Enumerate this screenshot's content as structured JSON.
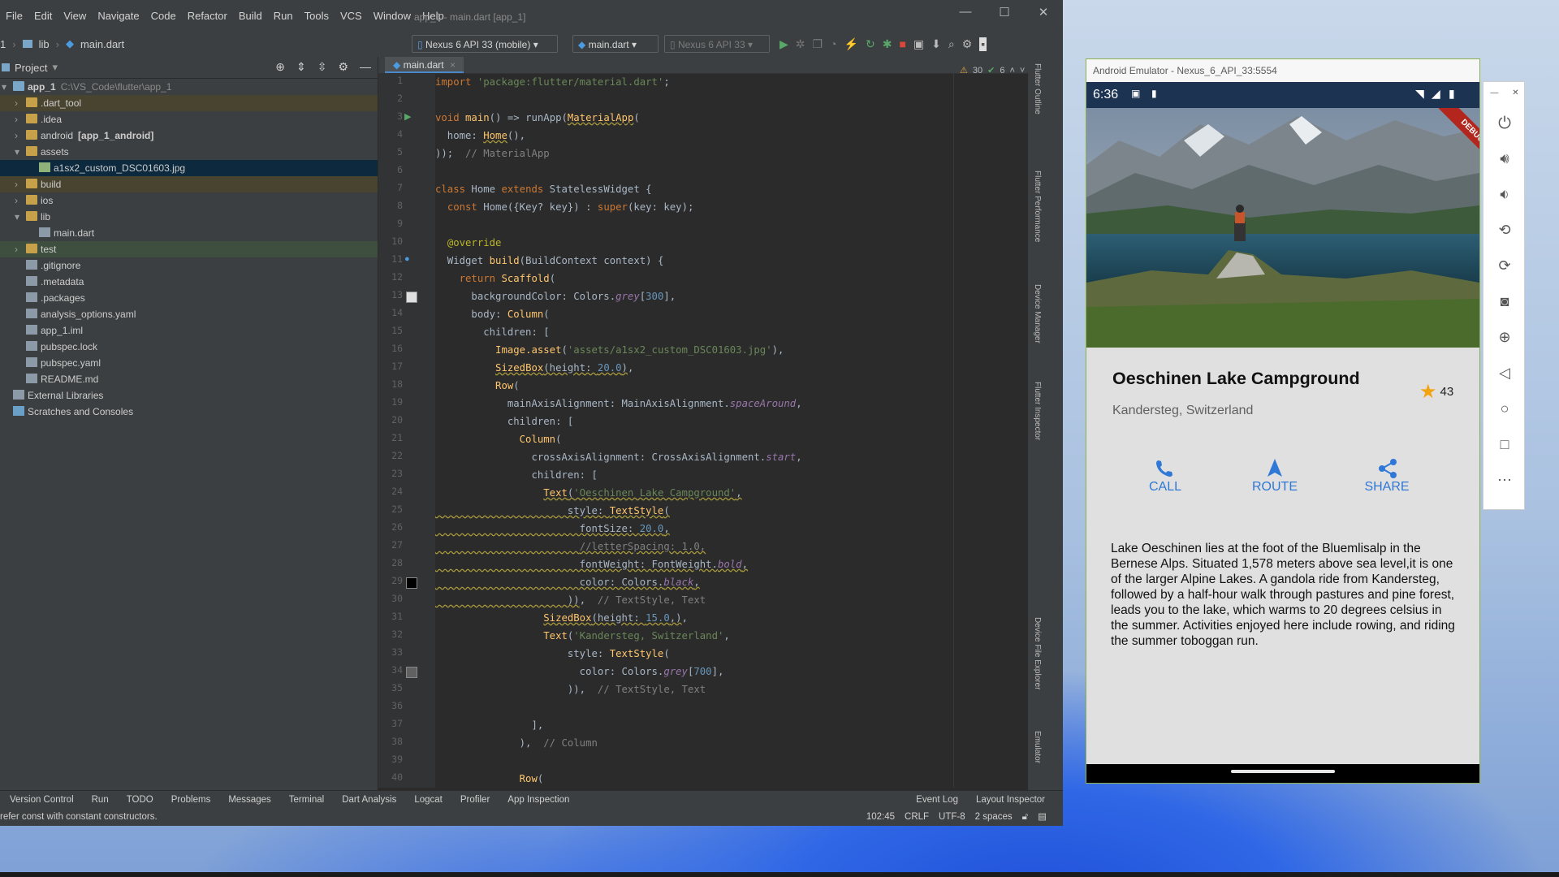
{
  "ide": {
    "menu": [
      "File",
      "Edit",
      "View",
      "Navigate",
      "Code",
      "Refactor",
      "Build",
      "Run",
      "Tools",
      "VCS",
      "Window",
      "Help"
    ],
    "window_title": "app_1 - main.dart [app_1]",
    "breadcrumb": [
      "1",
      "lib",
      "main.dart"
    ],
    "device_combo": "Nexus 6 API 33 (mobile)",
    "config_combo": "main.dart",
    "run_device_combo": "Nexus 6 API 33",
    "project_label": "Project",
    "tab_label": "main.dart",
    "inspection": {
      "warnings": "30",
      "checks": "6"
    },
    "tree": [
      {
        "label": "app_1",
        "extra": "C:\\VS_Code\\flutter\\app_1",
        "indent": 0,
        "arrow": "▾",
        "type": "module",
        "style": ""
      },
      {
        "label": ".dart_tool",
        "indent": 1,
        "arrow": "›",
        "type": "folder",
        "style": "hl"
      },
      {
        "label": ".idea",
        "indent": 1,
        "arrow": "›",
        "type": "folder",
        "style": ""
      },
      {
        "label": "android",
        "extra": "[app_1_android]",
        "indent": 1,
        "arrow": "›",
        "type": "folder",
        "style": ""
      },
      {
        "label": "assets",
        "indent": 1,
        "arrow": "▾",
        "type": "folder",
        "style": ""
      },
      {
        "label": "a1sx2_custom_DSC01603.jpg",
        "indent": 2,
        "arrow": "",
        "type": "image",
        "style": "sel"
      },
      {
        "label": "build",
        "indent": 1,
        "arrow": "›",
        "type": "folder",
        "style": "hl"
      },
      {
        "label": "ios",
        "indent": 1,
        "arrow": "›",
        "type": "folder",
        "style": ""
      },
      {
        "label": "lib",
        "indent": 1,
        "arrow": "▾",
        "type": "folder",
        "style": ""
      },
      {
        "label": "main.dart",
        "indent": 2,
        "arrow": "",
        "type": "file",
        "style": ""
      },
      {
        "label": "test",
        "indent": 1,
        "arrow": "›",
        "type": "folder",
        "style": "gray-hl"
      },
      {
        "label": ".gitignore",
        "indent": 1,
        "arrow": "",
        "type": "file",
        "style": ""
      },
      {
        "label": ".metadata",
        "indent": 1,
        "arrow": "",
        "type": "file",
        "style": ""
      },
      {
        "label": ".packages",
        "indent": 1,
        "arrow": "",
        "type": "file",
        "style": ""
      },
      {
        "label": "analysis_options.yaml",
        "indent": 1,
        "arrow": "",
        "type": "file",
        "style": ""
      },
      {
        "label": "app_1.iml",
        "indent": 1,
        "arrow": "",
        "type": "file",
        "style": ""
      },
      {
        "label": "pubspec.lock",
        "indent": 1,
        "arrow": "",
        "type": "file",
        "style": ""
      },
      {
        "label": "pubspec.yaml",
        "indent": 1,
        "arrow": "",
        "type": "file",
        "style": ""
      },
      {
        "label": "README.md",
        "indent": 1,
        "arrow": "",
        "type": "file",
        "style": ""
      },
      {
        "label": "External Libraries",
        "indent": 0,
        "arrow": "",
        "type": "lib",
        "style": ""
      },
      {
        "label": "Scratches and Consoles",
        "indent": 0,
        "arrow": "",
        "type": "scratch",
        "style": ""
      }
    ],
    "code_lines": [
      "<span class=\"kw\">import</span> <span class=\"str\">'package:flutter/material.dart'</span>;",
      "",
      "<span class=\"kw\">void</span> <span class=\"cls\">main</span>() => runApp(<span class=\"cls err\">MaterialApp</span>(",
      "  home: <span class=\"cls err\">Home</span>(),",
      "));  <span class=\"cmt\">// MaterialApp</span>",
      "",
      "<span class=\"kw\">class</span> Home <span class=\"kw\">extends</span> StatelessWidget {",
      "  <span class=\"kw\">const</span> Home({Key? key}) : <span class=\"kw\">super</span>(key: key);",
      "",
      "  <span class=\"ann\">@override</span>",
      "  Widget <span class=\"cls\">build</span>(BuildContext context) {",
      "    <span class=\"kw\">return</span> <span class=\"cls\">Scaffold</span>(",
      "      backgroundColor: Colors.<span class=\"fld\">grey</span>[<span class=\"num\">300</span>],",
      "      body: <span class=\"cls\">Column</span>(",
      "        children: [",
      "          <span class=\"cls\">Image.asset</span>(<span class=\"str\">'assets/a1sx2_custom_DSC01603.jpg'</span>),",
      "          <span class=\"cls err\">SizedBox</span><span class=\"err\">(height: <span class=\"num\">20.0</span>)</span>,",
      "          <span class=\"cls\">Row</span>(",
      "            mainAxisAlignment: MainAxisAlignment.<span class=\"fld\">spaceAround</span>,",
      "            children: [",
      "              <span class=\"cls\">Column</span>(",
      "                crossAxisAlignment: CrossAxisAlignment.<span class=\"fld\">start</span>,",
      "                children: [",
      "                  <span class=\"cls err\">Text</span><span class=\"err\">(<span class=\"str\">'Oeschinen Lake Campground'</span>,</span>",
      "<span class=\"err\">                      style: <span class=\"cls\">TextStyle</span>(</span>",
      "<span class=\"err\">                        fontSize: <span class=\"num\">20.0</span>,</span>",
      "<span class=\"err\">                        <span class=\"cmt\">//letterSpacing: 1.0,</span></span>",
      "<span class=\"err\">                        fontWeight: FontWeight.<span class=\"fld\">bold</span>,</span>",
      "<span class=\"err\">                        color: Colors.<span class=\"fld\">black</span>,</span>",
      "<span class=\"err\">                      ))</span>,  <span class=\"cmt\">// TextStyle, Text</span>",
      "                  <span class=\"cls err\">SizedBox</span><span class=\"err\">(height: <span class=\"num\">15.0</span>,)</span>,",
      "                  <span class=\"cls\">Text</span>(<span class=\"str\">'Kandersteg, Switzerland'</span>,",
      "                      style: <span class=\"cls\">TextStyle</span>(",
      "                        color: Colors.<span class=\"fld\">grey</span>[<span class=\"num\">700</span>],",
      "                      )),  <span class=\"cmt\">// TextStyle, Text</span>",
      "",
      "                ],",
      "              ),  <span class=\"cmt\">// Column</span>",
      "",
      "              <span class=\"cls\">Row</span>("
    ],
    "tool_windows": [
      "Version Control",
      "Run",
      "TODO",
      "Problems",
      "Messages",
      "Terminal",
      "Dart Analysis",
      "Logcat",
      "Profiler",
      "App Inspection"
    ],
    "tool_windows_right": [
      "Event Log",
      "Layout Inspector"
    ],
    "status_message": "refer const with constant constructors.",
    "status_right": [
      "102:45",
      "CRLF",
      "UTF-8",
      "2 spaces"
    ],
    "side_panels": [
      "Flutter Outline",
      "Flutter Performance",
      "Device Manager",
      "Flutter Inspector",
      "Device File Explorer",
      "Emulator"
    ]
  },
  "emulator": {
    "window_title": "Android Emulator - Nexus_6_API_33:5554",
    "time": "6:36",
    "debug_banner": "DEBUG",
    "app": {
      "title": "Oeschinen Lake Campground",
      "subtitle": "Kandersteg, Switzerland",
      "rating": "43",
      "actions": [
        {
          "label": "CALL",
          "icon": "phone-icon"
        },
        {
          "label": "ROUTE",
          "icon": "navigation-icon"
        },
        {
          "label": "SHARE",
          "icon": "share-icon"
        }
      ],
      "description": "Lake Oeschinen lies at the foot of the Bluemlisalp in the Bernese Alps. Situated 1,578 meters above sea level,it is one of the larger Alpine Lakes. A gandola ride from Kandersteg, followed by a half-hour walk through pastures and pine forest, leads you to the lake, which warms to 20 degrees celsius in the summer. Activities enjoyed here include rowing, and riding the summer toboggan run.",
      "accent": "#2f78d6",
      "star_color": "#f2a30f"
    }
  }
}
